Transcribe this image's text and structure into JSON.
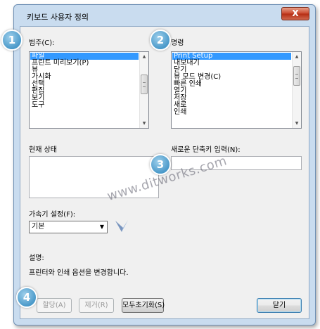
{
  "window": {
    "title": "키보드 사용자 정의",
    "close_label": "X"
  },
  "categories": {
    "label": "범주(C):",
    "items": [
      "파일",
      "프린트 미리보기(P)",
      "뷰",
      "가시화",
      "선택",
      "편집",
      "보기",
      "도구"
    ],
    "selected_index": 0
  },
  "commands": {
    "label": "명령",
    "items": [
      "Print Setup",
      "내보내기",
      "닫기",
      "뷰 모드 변경(C)",
      "빠른 인쇄",
      "열기",
      "저장",
      "새로",
      "인쇄"
    ],
    "selected_index": 0
  },
  "current_state": {
    "label": "현재 상태"
  },
  "new_shortcut": {
    "label": "새로운 단축키 입력(N):",
    "value": ""
  },
  "accelerator": {
    "label": "가속기 설정(F):",
    "selected": "기본"
  },
  "description": {
    "label": "설명:",
    "text": "프린터와 인쇄 옵션을 변경합니다."
  },
  "buttons": {
    "assign": "할당(A)",
    "remove": "제거(R)",
    "reset_all": "모두초기화(S)",
    "close": "닫기"
  },
  "badges": [
    "1",
    "2",
    "3",
    "4"
  ],
  "watermark": "www.ditworks.com",
  "colors": {
    "selection": "#3399ff",
    "badge": "#4a99c9",
    "frame": "#c9dcef"
  }
}
